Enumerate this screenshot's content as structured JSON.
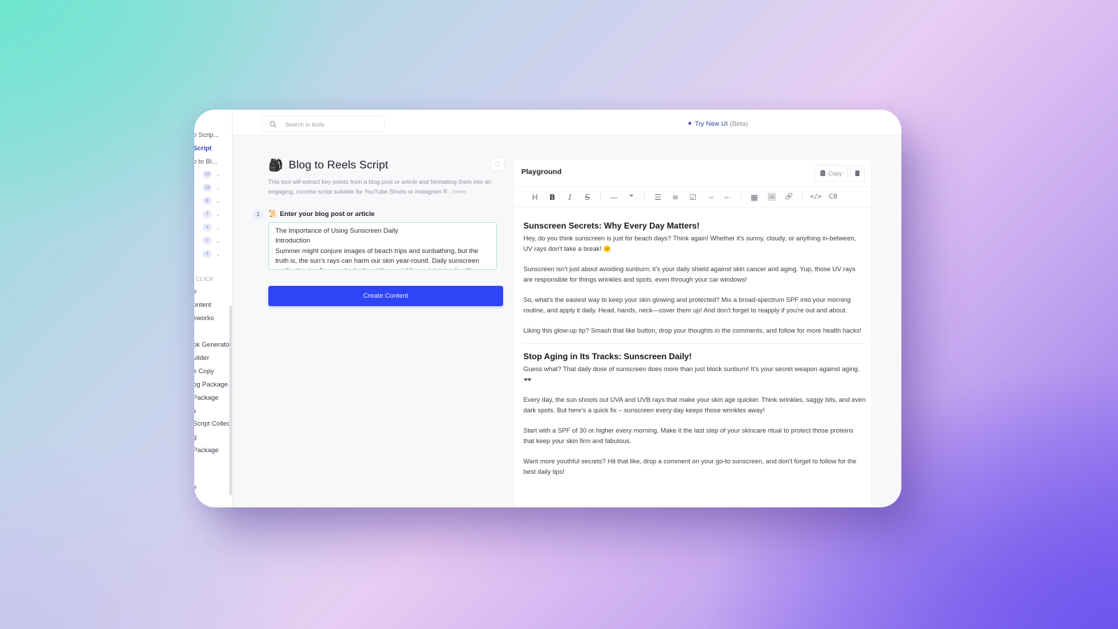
{
  "sidebar": {
    "items_top": [
      {
        "label": "o Scrip...",
        "active": false
      },
      {
        "label": "Script",
        "active": true
      },
      {
        "label": "o to Bl...",
        "active": false
      }
    ],
    "counts": [
      {
        "badge": "10"
      },
      {
        "badge": "18"
      },
      {
        "badge": "8"
      },
      {
        "badge": "7"
      },
      {
        "badge": "4"
      },
      {
        "badge": "1"
      },
      {
        "badge": "4"
      }
    ],
    "section_label": "CLICK",
    "items_bottom": [
      {
        "label": "e"
      },
      {
        "label": "ontent"
      },
      {
        "label": "eworks"
      },
      {
        "label": "ok Generato"
      },
      {
        "label": "uilder"
      },
      {
        "label": "e Copy"
      },
      {
        "label": "og Package"
      },
      {
        "label": " Package"
      },
      {
        "label": "s"
      },
      {
        "label": "Script Collec"
      },
      {
        "label": "g"
      },
      {
        "label": " Package"
      },
      {
        "label": "e"
      }
    ]
  },
  "topbar": {
    "search_placeholder": "Search in tools",
    "try_new_label": "Try New UI",
    "try_new_suffix": "(Beta)",
    "sparkle_glyph": "✦"
  },
  "tool": {
    "emoji": "🎒",
    "title": "Blog to Reels Script",
    "favorite_glyph": "♡",
    "description": "This tool will extract key points from a blog post or article and formatting them into an engaging, concise script suitable for YouTube Shorts or Instagram R",
    "more_label": "...more",
    "step": {
      "number": "1",
      "emoji": "📜",
      "label": "Enter your blog post or article",
      "value": "The Importance of Using Sunscreen Daily\nIntroduction\nSummer might conjure images of beach trips and sunbathing, but the truth is, the sun's rays can harm our skin year-round. Daily sunscreen application is often overlooked, yet it's crucial for maintaining healthy skin."
    },
    "create_button": "Create Content"
  },
  "playground": {
    "title": "Playground",
    "copy_label": "Copy",
    "toolbar": [
      {
        "name": "heading",
        "glyph": "H"
      },
      {
        "name": "bold",
        "glyph": "B"
      },
      {
        "name": "italic",
        "glyph": "I"
      },
      {
        "name": "strikethrough",
        "glyph": "S"
      },
      {
        "name": "horizontal-rule",
        "glyph": "—"
      },
      {
        "name": "quote",
        "glyph": "❝"
      },
      {
        "name": "bullet-list",
        "glyph": "☰"
      },
      {
        "name": "numbered-list",
        "glyph": "≡"
      },
      {
        "name": "task-list",
        "glyph": "☑"
      },
      {
        "name": "indent",
        "glyph": "⇥"
      },
      {
        "name": "outdent",
        "glyph": "⇤"
      },
      {
        "name": "table",
        "glyph": "▦"
      },
      {
        "name": "image",
        "glyph": "🖼"
      },
      {
        "name": "link",
        "glyph": "🔗"
      },
      {
        "name": "code",
        "glyph": "</>"
      },
      {
        "name": "code-block",
        "glyph": "CB"
      }
    ],
    "sections": [
      {
        "heading": "Sunscreen Secrets: Why Every Day Matters!",
        "paragraphs": [
          "Hey, do you think sunscreen is just for beach days? Think again! Whether it's sunny, cloudy, or anything in-between, UV rays don't take a break! 🌞",
          "Sunscreen isn't just about avoiding sunburn; it's your daily shield against skin cancer and aging. Yup, those UV rays are responsible for things wrinkles and spots, even through your car windows!",
          "So, what's the easiest way to keep your skin glowing and protected? Mix a broad-spectrum SPF into your morning routine, and apply it daily. Head, hands, neck—cover them up! And don't forget to reapply if you're out and about.",
          "Liking this glow-up tip? Smash that like button, drop your thoughts in the comments, and follow for more health hacks!"
        ]
      },
      {
        "heading": "Stop Aging in Its Tracks: Sunscreen Daily!",
        "paragraphs": [
          "Guess what? That daily dose of sunscreen does more than just block sunburn! It's your secret weapon against aging. 🕶",
          "Every day, the sun shoots out UVA and UVB rays that make your skin age quicker. Think wrinkles, saggy bits, and even dark spots. But here's a quick fix – sunscreen every day keeps those wrinkles away!",
          "Start with a SPF of 30 or higher every morning. Make it the last step of your skincare ritual to protect those proteins that keep your skin firm and fabulous.",
          "Want more youthful secrets? Hit that like, drop a comment on your go-to sunscreen, and don't forget to follow for the best daily tips!"
        ]
      }
    ]
  },
  "colors": {
    "accent": "#2f44f5",
    "link": "#3a44c9",
    "badge_bg": "#e6e8fb"
  }
}
